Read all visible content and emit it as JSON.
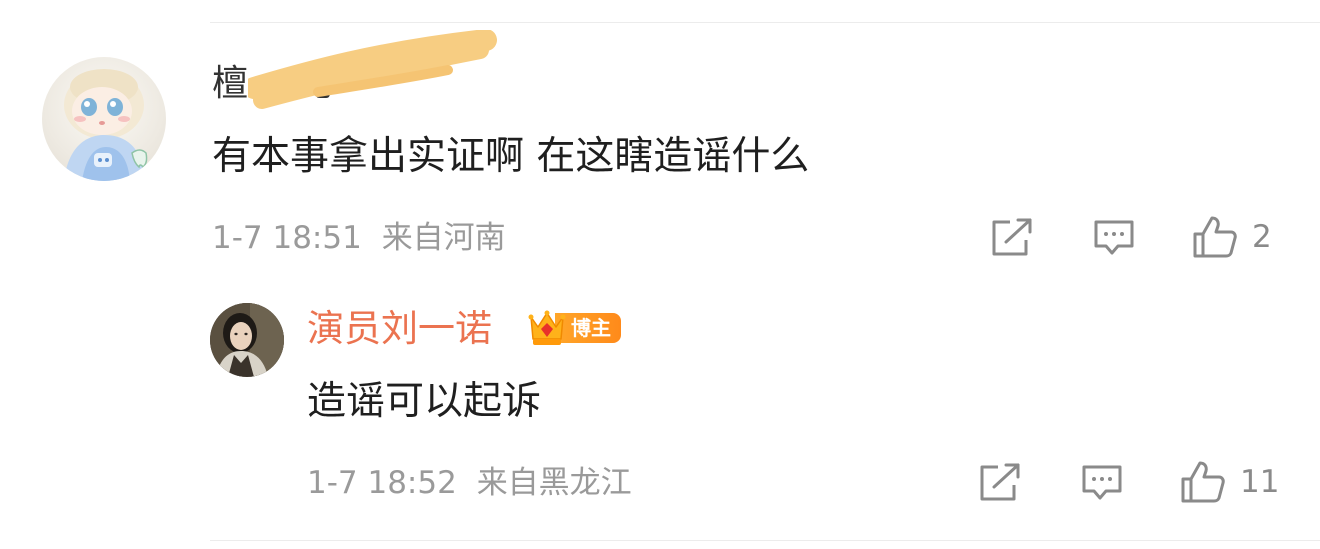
{
  "comment": {
    "author_visible": "檀一   兆",
    "text": "有本事拿出实证啊 在这瞎造谣什么",
    "timestamp": "1-7 18:51",
    "location": "来自河南",
    "like_count": "2"
  },
  "reply": {
    "author": "演员刘一诺",
    "badge_label": "博主",
    "text": "造谣可以起诉",
    "timestamp": "1-7 18:52",
    "location": "来自黑龙江",
    "like_count": "11"
  },
  "colors": {
    "reply_author": "#eb7350",
    "meta_text": "#9a9a9a",
    "scribble": "#f7cd82",
    "badge": "#ff8a1a"
  },
  "icons": {
    "share": "share-icon",
    "reply": "comment-icon",
    "like": "thumbs-up-icon"
  }
}
